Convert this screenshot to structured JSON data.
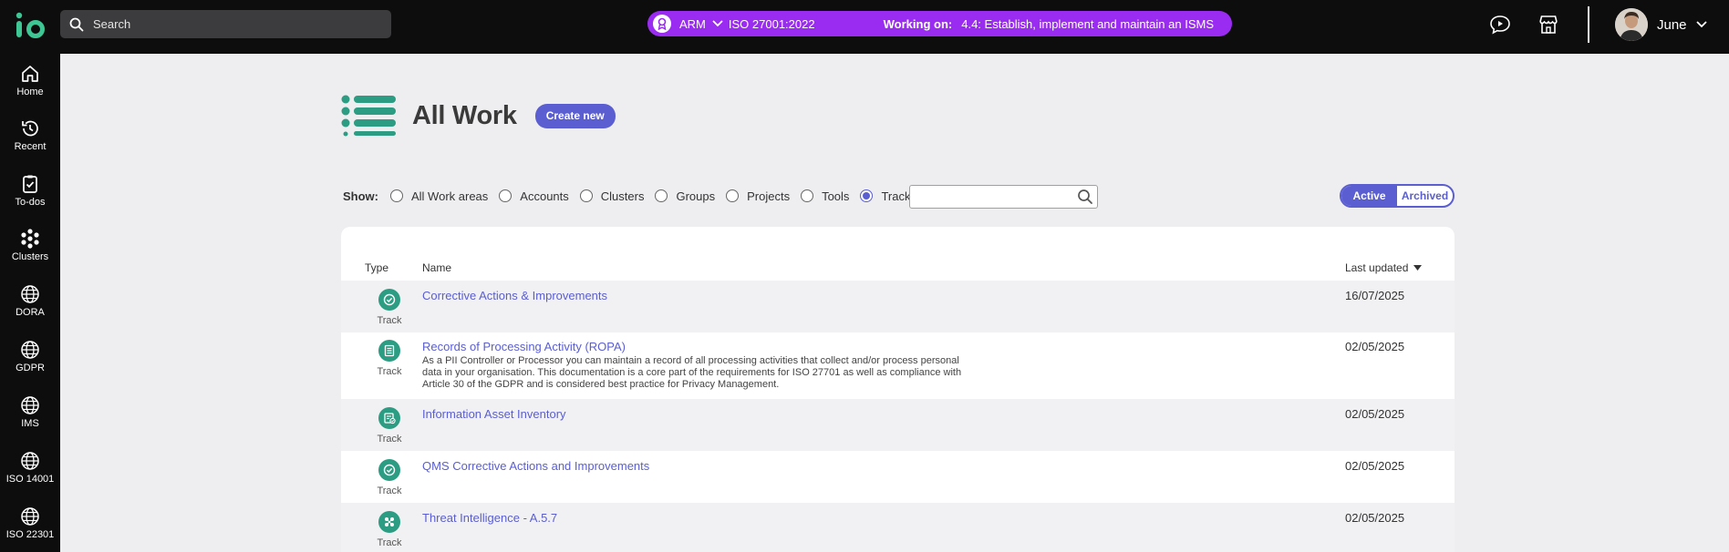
{
  "search": {
    "placeholder": "Search"
  },
  "context": {
    "org": "ARM",
    "standard": "ISO 27001:2022",
    "working_on_label": "Working on:",
    "task": "4.4: Establish, implement and maintain an ISMS",
    "color": "#9a2bf0"
  },
  "user": {
    "name": "June"
  },
  "sidebar": {
    "items": [
      {
        "label": "Home",
        "icon": "home-icon"
      },
      {
        "label": "Recent",
        "icon": "history-icon"
      },
      {
        "label": "To-dos",
        "icon": "clipboard-check-icon"
      },
      {
        "label": "Clusters",
        "icon": "clusters-icon"
      },
      {
        "label": "DORA",
        "icon": "globe-icon"
      },
      {
        "label": "GDPR",
        "icon": "globe-icon"
      },
      {
        "label": "IMS",
        "icon": "globe-icon"
      },
      {
        "label": "ISO 14001",
        "icon": "globe-icon"
      },
      {
        "label": "ISO 22301",
        "icon": "globe-icon"
      }
    ]
  },
  "page": {
    "title": "All Work",
    "create_label": "Create new"
  },
  "filters": {
    "show_label": "Show:",
    "options": [
      "All Work areas",
      "Accounts",
      "Clusters",
      "Groups",
      "Projects",
      "Tools",
      "Tracks"
    ],
    "selected": "Tracks",
    "search_value": ""
  },
  "status_toggle": {
    "active_label": "Active",
    "archived_label": "Archived",
    "selected": "Active"
  },
  "table": {
    "headers": {
      "type": "Type",
      "name": "Name",
      "last_updated": "Last updated"
    },
    "sort": "descending",
    "rows": [
      {
        "type": "Track",
        "icon": "check-circle-icon",
        "name": "Corrective Actions & Improvements",
        "description": "",
        "date": "16/07/2025"
      },
      {
        "type": "Track",
        "icon": "document-list-icon",
        "name": "Records of Processing Activity (ROPA)",
        "description_lines": [
          "As a PII Controller or Processor you can maintain a record of all processing activities that collect and/or process personal",
          "data in your organisation. This documentation is a core part of the requirements for ISO 27701 as well as compliance with",
          "Article 30 of the GDPR and is considered best practice for Privacy Management."
        ],
        "date": "02/05/2025"
      },
      {
        "type": "Track",
        "icon": "asset-inventory-icon",
        "name": "Information Asset Inventory",
        "description": "",
        "date": "02/05/2025"
      },
      {
        "type": "Track",
        "icon": "check-circle-icon",
        "name": "QMS Corrective Actions and Improvements",
        "description": "",
        "date": "02/05/2025"
      },
      {
        "type": "Track",
        "icon": "threat-network-icon",
        "name": "Threat Intelligence - A.5.7",
        "description": "",
        "date": "02/05/2025"
      }
    ]
  },
  "colors": {
    "accent": "#5a5ed0",
    "track_icon": "#2c9d82",
    "logo": "#3ec795"
  }
}
